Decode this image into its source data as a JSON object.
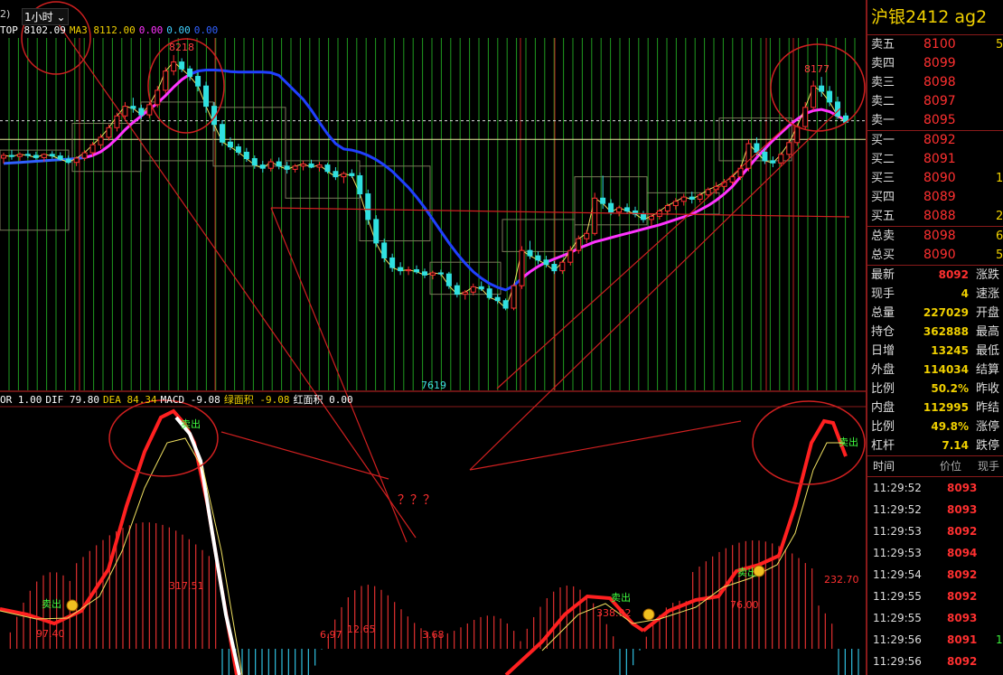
{
  "top_bar": {
    "left_tag": "2)",
    "period": "1小时",
    "period_arrow": "chevron-down-icon"
  },
  "main_legend": [
    {
      "text": "TOP 8102.09",
      "color": "#ffffff"
    },
    {
      "text": "MA3 8112.00",
      "color": "#f0d000"
    },
    {
      "text": "0.00",
      "color": "#ff33ff"
    },
    {
      "text": "0.00",
      "color": "#40d0ff"
    },
    {
      "text": "0.00",
      "color": "#3060ff"
    }
  ],
  "macd_legend": [
    {
      "text": "OR 1.00",
      "color": "#ffffff"
    },
    {
      "text": "DIF 79.80",
      "color": "#ffffff"
    },
    {
      "text": "DEA 84.34",
      "color": "#f0d000"
    },
    {
      "text": "MACD -9.08",
      "color": "#ffffff"
    },
    {
      "text": "绿面积 -9.08",
      "color": "#f0d000"
    },
    {
      "text": "红面积 0.00",
      "color": "#ffffff"
    }
  ],
  "annotations": {
    "high1": "8218",
    "high2": "8177",
    "low": "7619",
    "question": "？？？",
    "m1": "97.40",
    "m2": "317.51",
    "m3": "6.97",
    "m4": "12.65",
    "m5": "3.68",
    "m6": "338.92",
    "m7": "76.00",
    "m8": "232.70",
    "sell_tag": "卖出"
  },
  "panel": {
    "contract": "沪银2412  ag2",
    "asks": [
      {
        "label": "卖五",
        "price": "8100",
        "vol": "5"
      },
      {
        "label": "卖四",
        "price": "8099",
        "vol": ""
      },
      {
        "label": "卖三",
        "price": "8098",
        "vol": ""
      },
      {
        "label": "卖二",
        "price": "8097",
        "vol": ""
      },
      {
        "label": "卖一",
        "price": "8095",
        "vol": ""
      }
    ],
    "bids": [
      {
        "label": "买一",
        "price": "8092",
        "vol": ""
      },
      {
        "label": "买二",
        "price": "8091",
        "vol": ""
      },
      {
        "label": "买三",
        "price": "8090",
        "vol": "1"
      },
      {
        "label": "买四",
        "price": "8089",
        "vol": ""
      },
      {
        "label": "买五",
        "price": "8088",
        "vol": "2"
      }
    ],
    "totals": [
      {
        "label": "总卖",
        "price": "8098",
        "vol": "6"
      },
      {
        "label": "总买",
        "price": "8090",
        "vol": "5"
      }
    ],
    "stats": [
      {
        "label": "最新",
        "value": "8092",
        "color": "red",
        "label2": "涨跌"
      },
      {
        "label": "现手",
        "value": "4",
        "color": "yel",
        "label2": "速涨"
      },
      {
        "label": "总量",
        "value": "227029",
        "color": "yel",
        "label2": "开盘"
      },
      {
        "label": "持仓",
        "value": "362888",
        "color": "yel",
        "label2": "最高"
      },
      {
        "label": "日增",
        "value": "13245",
        "color": "yel",
        "label2": "最低"
      },
      {
        "label": "外盘",
        "value": "114034",
        "color": "yel",
        "label2": "结算"
      },
      {
        "label": "比例",
        "value": "50.2%",
        "color": "yel",
        "label2": "昨收"
      },
      {
        "label": "内盘",
        "value": "112995",
        "color": "yel",
        "label2": "昨结"
      },
      {
        "label": "比例",
        "value": "49.8%",
        "color": "yel",
        "label2": "涨停"
      },
      {
        "label": "杠杆",
        "value": "7.14",
        "color": "yel",
        "label2": "跌停"
      }
    ],
    "ticks_header": {
      "time": "时间",
      "price": "价位",
      "vol": "现手"
    },
    "ticks": [
      {
        "time": "11:29:52",
        "price": "8093",
        "vol": ""
      },
      {
        "time": "11:29:52",
        "price": "8093",
        "vol": ""
      },
      {
        "time": "11:29:53",
        "price": "8092",
        "vol": ""
      },
      {
        "time": "11:29:53",
        "price": "8094",
        "vol": ""
      },
      {
        "time": "11:29:54",
        "price": "8092",
        "vol": ""
      },
      {
        "time": "11:29:55",
        "price": "8092",
        "vol": ""
      },
      {
        "time": "11:29:55",
        "price": "8093",
        "vol": ""
      },
      {
        "time": "11:29:56",
        "price": "8091",
        "vol": "1("
      },
      {
        "time": "11:29:56",
        "price": "8092",
        "vol": ""
      }
    ]
  },
  "chart_data": {
    "type": "candlestick",
    "price_range": [
      7590,
      8250
    ],
    "reference_lines": [
      8095,
      8060
    ],
    "candles": [
      [
        8025,
        8035,
        8015,
        8030
      ],
      [
        8030,
        8040,
        8022,
        8028
      ],
      [
        8028,
        8036,
        8020,
        8032
      ],
      [
        8032,
        8040,
        8025,
        8030
      ],
      [
        8030,
        8037,
        8022,
        8026
      ],
      [
        8026,
        8034,
        8018,
        8032
      ],
      [
        8032,
        8038,
        8024,
        8029
      ],
      [
        8029,
        8036,
        8020,
        8023
      ],
      [
        8023,
        8030,
        8014,
        8017
      ],
      [
        8017,
        8028,
        8010,
        8025
      ],
      [
        8025,
        8040,
        8020,
        8035
      ],
      [
        8035,
        8055,
        8028,
        8050
      ],
      [
        8050,
        8070,
        8042,
        8064
      ],
      [
        8064,
        8088,
        8058,
        8082
      ],
      [
        8082,
        8110,
        8075,
        8104
      ],
      [
        8104,
        8130,
        8096,
        8122
      ],
      [
        8122,
        8138,
        8110,
        8118
      ],
      [
        8118,
        8125,
        8098,
        8106
      ],
      [
        8106,
        8130,
        8100,
        8125
      ],
      [
        8125,
        8160,
        8120,
        8152
      ],
      [
        8152,
        8195,
        8146,
        8188
      ],
      [
        8188,
        8218,
        8180,
        8205
      ],
      [
        8205,
        8212,
        8186,
        8192
      ],
      [
        8192,
        8198,
        8170,
        8178
      ],
      [
        8178,
        8186,
        8150,
        8160
      ],
      [
        8160,
        8168,
        8110,
        8122
      ],
      [
        8122,
        8130,
        8075,
        8088
      ],
      [
        8088,
        8096,
        8048,
        8055
      ],
      [
        8055,
        8064,
        8040,
        8046
      ],
      [
        8046,
        8052,
        8030,
        8036
      ],
      [
        8036,
        8044,
        8018,
        8024
      ],
      [
        8024,
        8030,
        8005,
        8012
      ],
      [
        8012,
        8020,
        7998,
        8006
      ],
      [
        8006,
        8024,
        8000,
        8018
      ],
      [
        8018,
        8026,
        8004,
        8010
      ],
      [
        8010,
        8018,
        7996,
        8004
      ],
      [
        8004,
        8014,
        7998,
        8010
      ],
      [
        8010,
        8020,
        8002,
        8014
      ],
      [
        8014,
        8022,
        8006,
        8008
      ],
      [
        8008,
        8018,
        8000,
        8012
      ],
      [
        8012,
        8016,
        7996,
        8000
      ],
      [
        8000,
        8008,
        7984,
        7990
      ],
      [
        7990,
        8000,
        7978,
        7996
      ],
      [
        7996,
        8004,
        7988,
        7992
      ],
      [
        7992,
        7998,
        7950,
        7958
      ],
      [
        7958,
        7966,
        7900,
        7910
      ],
      [
        7910,
        7918,
        7858,
        7866
      ],
      [
        7866,
        7874,
        7830,
        7838
      ],
      [
        7838,
        7846,
        7812,
        7820
      ],
      [
        7820,
        7830,
        7806,
        7814
      ],
      [
        7814,
        7822,
        7806,
        7816
      ],
      [
        7816,
        7824,
        7808,
        7812
      ],
      [
        7812,
        7818,
        7800,
        7806
      ],
      [
        7806,
        7814,
        7798,
        7810
      ],
      [
        7810,
        7816,
        7804,
        7808
      ],
      [
        7808,
        7812,
        7780,
        7786
      ],
      [
        7786,
        7792,
        7764,
        7770
      ],
      [
        7770,
        7778,
        7760,
        7774
      ],
      [
        7774,
        7790,
        7768,
        7784
      ],
      [
        7784,
        7794,
        7776,
        7780
      ],
      [
        7780,
        7786,
        7760,
        7764
      ],
      [
        7764,
        7770,
        7752,
        7758
      ],
      [
        7758,
        7762,
        7740,
        7744
      ],
      [
        7744,
        7790,
        7740,
        7786
      ],
      [
        7786,
        7860,
        7780,
        7852
      ],
      [
        7852,
        7870,
        7836,
        7842
      ],
      [
        7842,
        7850,
        7826,
        7834
      ],
      [
        7834,
        7842,
        7820,
        7826
      ],
      [
        7826,
        7832,
        7808,
        7814
      ],
      [
        7814,
        7834,
        7808,
        7830
      ],
      [
        7830,
        7860,
        7824,
        7852
      ],
      [
        7852,
        7880,
        7846,
        7874
      ],
      [
        7874,
        7890,
        7866,
        7884
      ],
      [
        7884,
        7960,
        7880,
        7950
      ],
      [
        7950,
        7992,
        7930,
        7940
      ],
      [
        7940,
        7948,
        7918,
        7924
      ],
      [
        7924,
        7936,
        7916,
        7932
      ],
      [
        7932,
        7940,
        7920,
        7926
      ],
      [
        7926,
        7934,
        7914,
        7920
      ],
      [
        7920,
        7926,
        7904,
        7910
      ],
      [
        7910,
        7920,
        7898,
        7916
      ],
      [
        7916,
        7930,
        7910,
        7926
      ],
      [
        7926,
        7940,
        7918,
        7936
      ],
      [
        7936,
        7950,
        7928,
        7944
      ],
      [
        7944,
        7958,
        7936,
        7952
      ],
      [
        7952,
        7962,
        7940,
        7948
      ],
      [
        7948,
        7960,
        7942,
        7956
      ],
      [
        7956,
        7970,
        7950,
        7966
      ],
      [
        7966,
        7980,
        7958,
        7972
      ],
      [
        7972,
        7986,
        7964,
        7980
      ],
      [
        7980,
        7994,
        7974,
        7990
      ],
      [
        7990,
        8012,
        7984,
        8006
      ],
      [
        8006,
        8060,
        8000,
        8052
      ],
      [
        8052,
        8064,
        8030,
        8036
      ],
      [
        8036,
        8044,
        8014,
        8020
      ],
      [
        8020,
        8028,
        8008,
        8016
      ],
      [
        8016,
        8036,
        8010,
        8032
      ],
      [
        8032,
        8060,
        8026,
        8054
      ],
      [
        8054,
        8090,
        8048,
        8084
      ],
      [
        8084,
        8130,
        8078,
        8120
      ],
      [
        8120,
        8170,
        8114,
        8160
      ],
      [
        8160,
        8177,
        8140,
        8150
      ],
      [
        8150,
        8160,
        8122,
        8130
      ],
      [
        8130,
        8140,
        8098,
        8104
      ],
      [
        8104,
        8110,
        8090,
        8092
      ]
    ],
    "ma_line": [
      8015,
      8016,
      8017,
      8018,
      8019,
      8020,
      8021,
      8022,
      8023,
      8024,
      8026,
      8030,
      8037,
      8048,
      8062,
      8078,
      8092,
      8104,
      8116,
      8128,
      8142,
      8158,
      8172,
      8182,
      8188,
      8190,
      8190,
      8189,
      8187,
      8186,
      8186,
      8186,
      8186,
      8185,
      8180,
      8165,
      8150,
      8135,
      8115,
      8092,
      8070,
      8052,
      8042,
      8040,
      8036,
      8030,
      8022,
      8012,
      8000,
      7985,
      7970,
      7952,
      7932,
      7910,
      7888,
      7866,
      7846,
      7828,
      7812,
      7800,
      7790,
      7783,
      7778,
      7786,
      7800,
      7812,
      7822,
      7830,
      7836,
      7842,
      7848,
      7856,
      7862,
      7868,
      7872,
      7876,
      7880,
      7884,
      7888,
      7892,
      7896,
      7900,
      7905,
      7910,
      7915,
      7920,
      7928,
      7936,
      7946,
      7958,
      7972,
      7990,
      8008,
      8026,
      8042,
      8058,
      8072,
      8086,
      8098,
      8108,
      8114,
      8116,
      8112,
      8104,
      8096
    ]
  }
}
